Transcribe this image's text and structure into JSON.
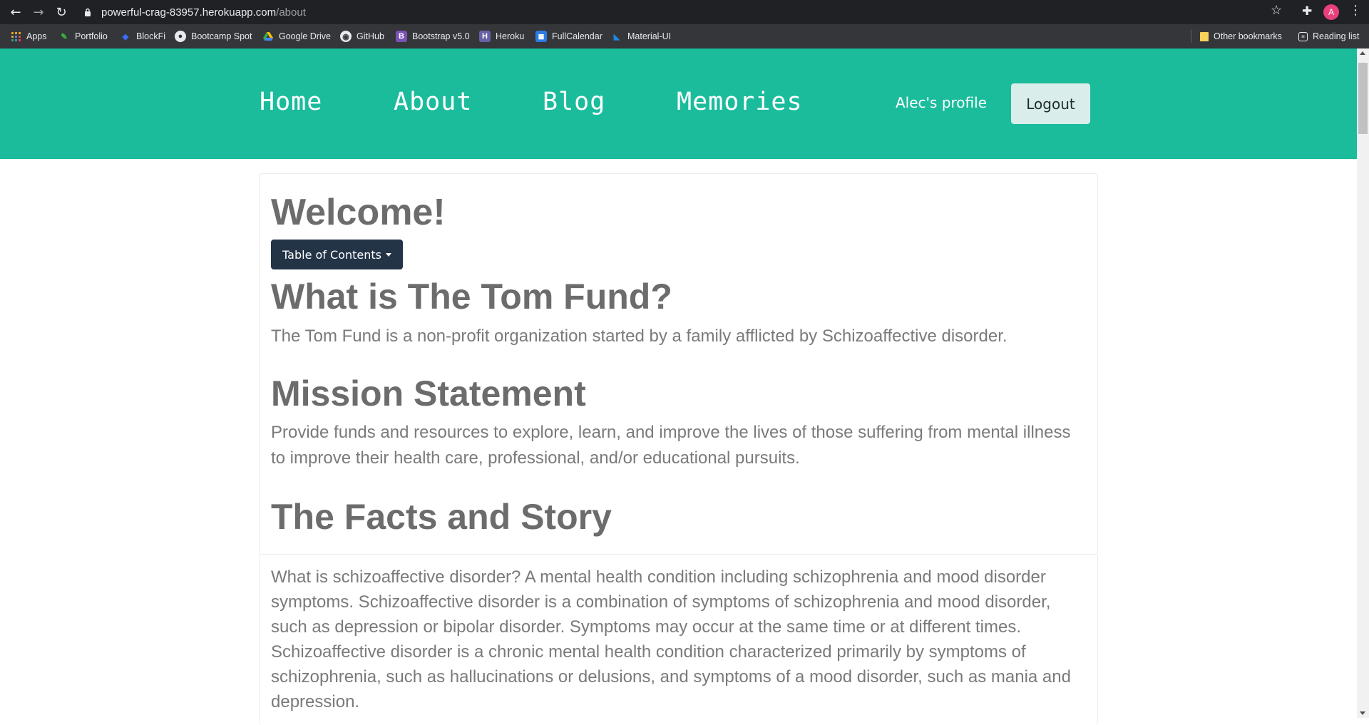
{
  "browser": {
    "url_host": "powerful-crag-83957.herokuapp.com",
    "url_path": "/about",
    "avatar_letter": "A",
    "bookmarks": [
      {
        "label": "Apps",
        "icon": "apps-grid-icon"
      },
      {
        "label": "Portfolio",
        "icon": "portfolio-icon"
      },
      {
        "label": "BlockFi",
        "icon": "blockfi-icon"
      },
      {
        "label": "Bootcamp Spot",
        "icon": "bootcamp-spot-icon"
      },
      {
        "label": "Google Drive",
        "icon": "google-drive-icon"
      },
      {
        "label": "GitHub",
        "icon": "github-icon"
      },
      {
        "label": "Bootstrap v5.0",
        "icon": "bootstrap-icon"
      },
      {
        "label": "Heroku",
        "icon": "heroku-icon"
      },
      {
        "label": "FullCalendar",
        "icon": "fullcalendar-icon"
      },
      {
        "label": "Material-UI",
        "icon": "material-ui-icon"
      }
    ],
    "other_bookmarks": "Other bookmarks",
    "reading_list": "Reading list"
  },
  "nav": {
    "home": "Home",
    "about": "About",
    "blog": "Blog",
    "memories": "Memories",
    "profile": "Alec's profile",
    "logout": "Logout"
  },
  "content": {
    "welcome": "Welcome!",
    "toc_button": "Table of Contents",
    "what_heading": "What is The Tom Fund?",
    "what_text": "The Tom Fund is a non-profit organization started by a family afflicted by Schizoaffective disorder.",
    "mission_heading": "Mission Statement",
    "mission_text": "Provide funds and resources to explore, learn, and improve the lives of those suffering from mental illness to improve their health care, professional, and/or educational pursuits.",
    "facts_heading": "The Facts and Story",
    "facts_text": "What is schizoaffective disorder? A mental health condition including schizophrenia and mood disorder symptoms. Schizoaffective disorder is a combination of symptoms of schizophrenia and mood disorder, such as depression or bipolar disorder. Symptoms may occur at the same time or at different times. Schizoaffective disorder is a chronic mental health condition characterized primarily by symptoms of schizophrenia, such as hallucinations or delusions, and symptoms of a mood disorder, such as mania and depression."
  },
  "colors": {
    "navbar": "#1abc9c",
    "toc_button": "#243447",
    "logout_button": "#d9edeb",
    "text_gray": "#7a7a7a"
  }
}
